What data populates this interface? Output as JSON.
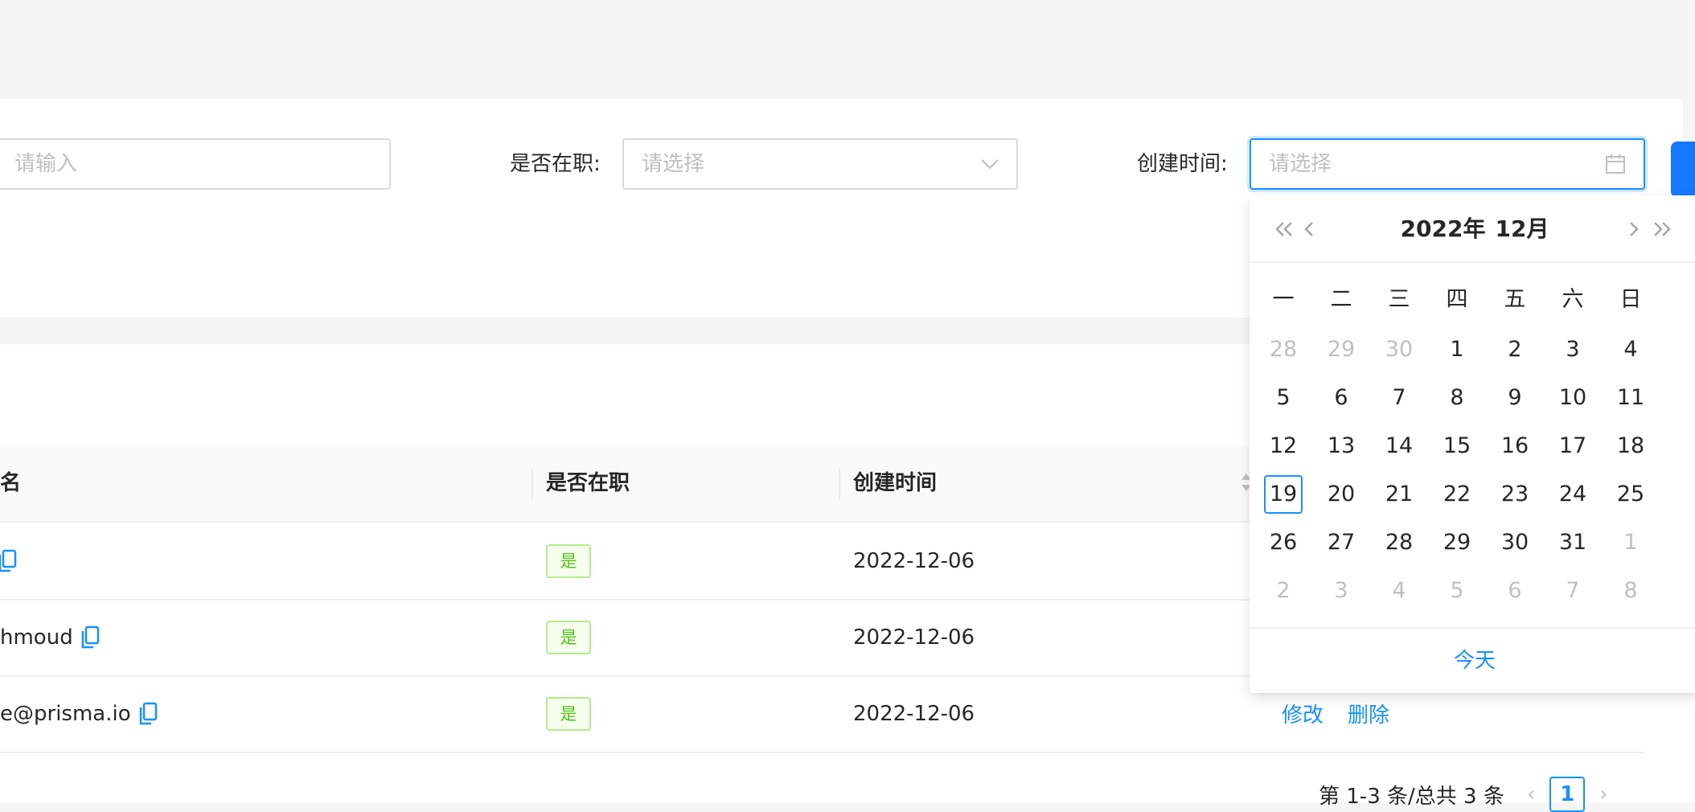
{
  "search_form": {
    "name_input_placeholder": "请输入",
    "status_label": "是否在职",
    "status_placeholder": "请选择",
    "created_label": "创建时间",
    "created_placeholder": "请选择",
    "label_colon": ":"
  },
  "table": {
    "columns": [
      "名",
      "是否在职",
      "创建时间"
    ],
    "rows": [
      {
        "name": "",
        "status": "是",
        "created": "2022-12-06"
      },
      {
        "name": "hmoud",
        "status": "是",
        "created": "2022-12-06"
      },
      {
        "name": "e@prisma.io",
        "status": "是",
        "created": "2022-12-06",
        "actions": [
          "修改",
          "删除"
        ]
      }
    ]
  },
  "pagination": {
    "summary": "第 1-3 条/总共 3 条",
    "current_page": "1"
  },
  "date_picker": {
    "year": "2022年",
    "month": "12月",
    "weekdays": [
      "一",
      "二",
      "三",
      "四",
      "五",
      "六",
      "日"
    ],
    "weeks": [
      [
        "28",
        "29",
        "30",
        "1",
        "2",
        "3",
        "4"
      ],
      [
        "5",
        "6",
        "7",
        "8",
        "9",
        "10",
        "11"
      ],
      [
        "12",
        "13",
        "14",
        "15",
        "16",
        "17",
        "18"
      ],
      [
        "19",
        "20",
        "21",
        "22",
        "23",
        "24",
        "25"
      ],
      [
        "26",
        "27",
        "28",
        "29",
        "30",
        "31",
        "1"
      ],
      [
        "2",
        "3",
        "4",
        "5",
        "6",
        "7",
        "8"
      ]
    ],
    "dimmed": [
      [
        0,
        0
      ],
      [
        0,
        1
      ],
      [
        0,
        2
      ],
      [
        4,
        6
      ],
      [
        5,
        0
      ],
      [
        5,
        1
      ],
      [
        5,
        2
      ],
      [
        5,
        3
      ],
      [
        5,
        4
      ],
      [
        5,
        5
      ],
      [
        5,
        6
      ]
    ],
    "today_cell": [
      3,
      0
    ],
    "today_label": "今天"
  },
  "colors": {
    "primary": "#1890ff",
    "success_tag": "#52c41a",
    "placeholder": "#bfbfbf"
  },
  "icons": [
    "chevron-down-icon",
    "calendar-icon",
    "copy-icon",
    "double-left-icon",
    "left-icon",
    "right-icon",
    "double-right-icon"
  ]
}
